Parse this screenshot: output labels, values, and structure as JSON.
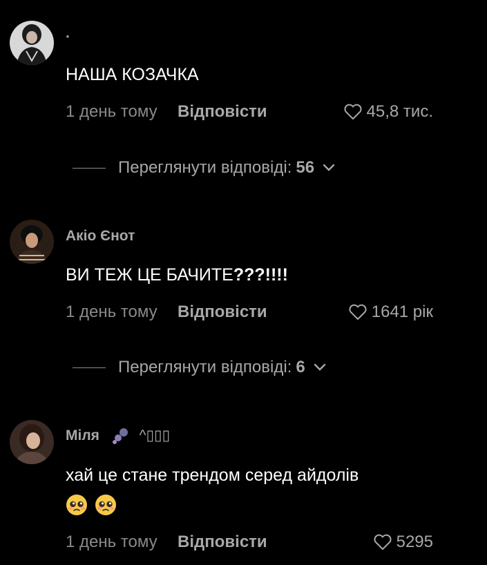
{
  "comments": [
    {
      "username": "·",
      "text": "НАША КОЗАЧКА",
      "time": "1 день тому",
      "reply_label": "Відповісти",
      "likes": "45,8 тис.",
      "view_replies_label": "Переглянути відповіді:",
      "view_replies_count": "56"
    },
    {
      "username": "Акіо Єнот",
      "text_main": "ВИ ТЕЖ ЦЕ БАЧИТЕ",
      "text_bold": "???!!!!",
      "time": "1 день тому",
      "reply_label": "Відповісти",
      "likes": "1641 рік",
      "view_replies_label": "Переглянути відповіді:",
      "view_replies_count": "6"
    },
    {
      "username": "Міля",
      "username_extra": "^▯▯▯",
      "text": "хай це стане трендом серед айдолів",
      "emojis": [
        "pleading-face",
        "pleading-face"
      ],
      "time": "1 день тому",
      "reply_label": "Відповісти",
      "likes": "5295"
    }
  ],
  "colors": {
    "background": "#000000",
    "text_primary": "#ffffff",
    "text_secondary": "#a8a8a8",
    "text_muted": "#8a8a8a"
  }
}
